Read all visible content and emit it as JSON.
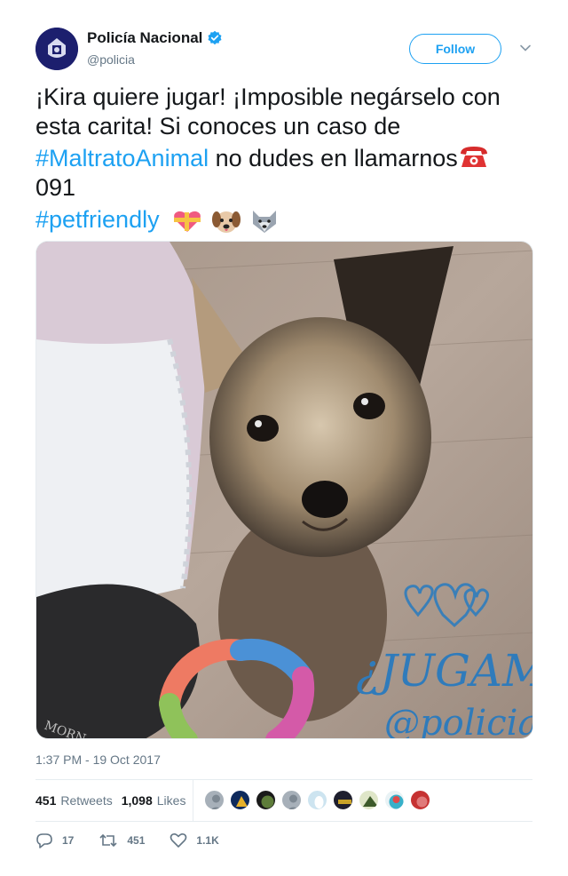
{
  "author": {
    "name": "Policía Nacional",
    "handle": "@policia",
    "verified": true,
    "follow_label": "Follow"
  },
  "tweet": {
    "line1": "¡Kira quiere jugar! ¡Imposible negárselo con esta carita! Si conoces un caso de",
    "hashtag1": "#MaltratoAnimal",
    "line2_rest": " no dudes en llamarnos",
    "line3": "091",
    "hashtag2": "#petfriendly"
  },
  "image": {
    "overlay_text": "¿JUGAMOS?",
    "overlay_handle": "@policia",
    "brand_text": "MORN"
  },
  "timestamp": "1:37 PM - 19 Oct 2017",
  "stats": {
    "retweets_count": "451",
    "retweets_label": "Retweets",
    "likes_count": "1,098",
    "likes_label": "Likes"
  },
  "actions": {
    "replies": "17",
    "retweets": "451",
    "likes": "1.1K"
  },
  "colors": {
    "accent": "#1da1f2",
    "muted": "#657786",
    "text": "#14171a"
  }
}
